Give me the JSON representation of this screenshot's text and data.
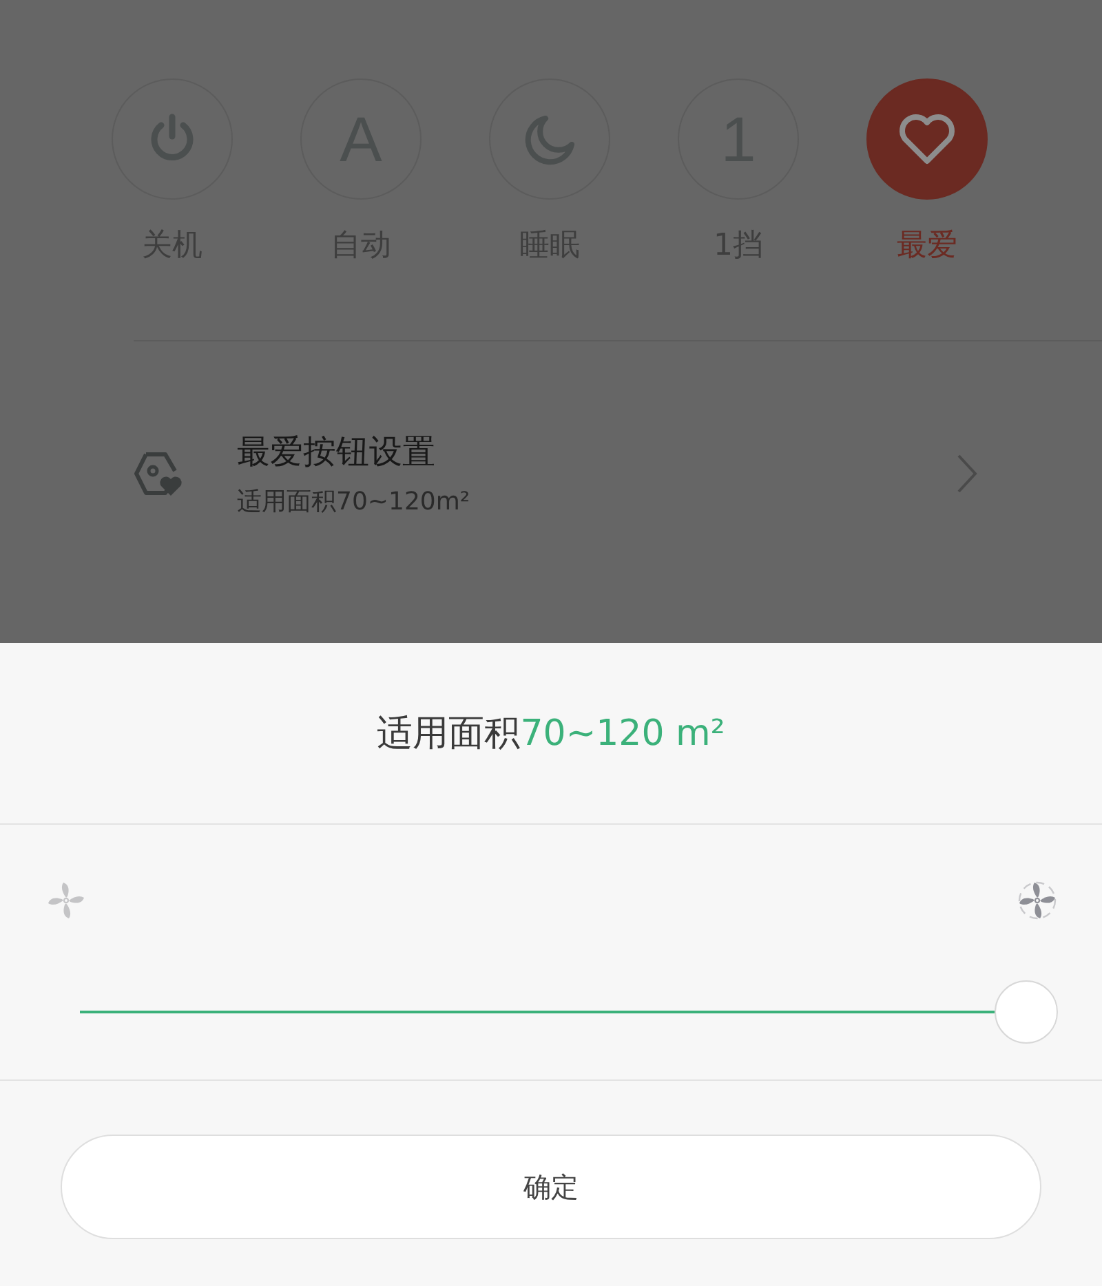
{
  "modes": [
    {
      "kind": "power",
      "label": "关机",
      "selected": false
    },
    {
      "kind": "letter",
      "glyph": "A",
      "label": "自动",
      "selected": false
    },
    {
      "kind": "moon",
      "label": "睡眠",
      "selected": false
    },
    {
      "kind": "letter",
      "glyph": "1",
      "label": "1挡",
      "selected": false
    },
    {
      "kind": "heart",
      "label": "最爱",
      "selected": true
    }
  ],
  "setting": {
    "title": "最爱按钮设置",
    "subtitle": "适用面积70~120m²"
  },
  "sheet": {
    "title": "适用面积",
    "title_value": "70~120 m²",
    "slider": {
      "level": 1
    },
    "confirm": "确定"
  }
}
